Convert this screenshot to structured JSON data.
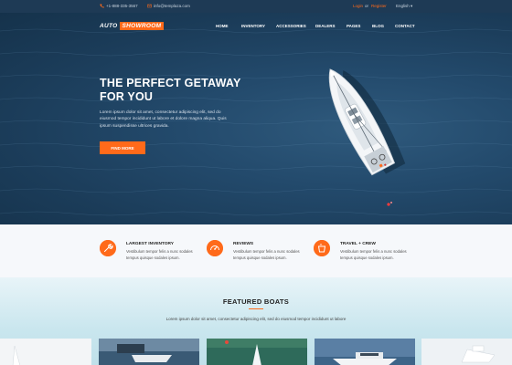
{
  "topbar": {
    "phone": "+1-888-335-3567",
    "email": "info@templaza.com",
    "login": "Login",
    "or": "or",
    "register": "Register",
    "language": "English",
    "language_caret": "▾"
  },
  "logo": {
    "part1": "AUTO",
    "part2": "SHOWROOM"
  },
  "nav": [
    "HOME",
    "INVENTORY",
    "ACCESSORIES",
    "DEALERS",
    "PAGES",
    "BLOG",
    "CONTACT"
  ],
  "hero": {
    "title_line1": "THE PERFECT GETAWAY",
    "title_line2": "FOR YOU",
    "description": "Lorem ipsum dolor sit amet, consectetur adipiscing elit, sed do eiusmod tempor incididunt ut labore et dolore magna aliqua. Quis ipsum suspendisse ultrices gravida.",
    "cta": "FIND MORE"
  },
  "features": [
    {
      "title": "LARGEST INVENTORY",
      "text": "Vestibulum tempor felis a nunc sodales tempus quisque sodales ipsum.",
      "icon": "wrench-icon"
    },
    {
      "title": "REVIEWS",
      "text": "Vestibulum tempor felis a nunc sodales tempus quisque sodales ipsum.",
      "icon": "gauge-icon"
    },
    {
      "title": "TRAVEL + CREW",
      "text": "Vestibulum tempor felis a nunc sodales tempus quisque sodales ipsum.",
      "icon": "cup-icon"
    }
  ],
  "featured": {
    "title": "FEATURED BOATS",
    "subtitle": "Lorem ipsum dolor sit amet, consectetur adipiscing elit, sed do eiusmod tempor incididunt ut labore"
  },
  "colors": {
    "accent": "#ff6a1a",
    "topbar": "#1e3a55",
    "hero": "#1f4463"
  }
}
